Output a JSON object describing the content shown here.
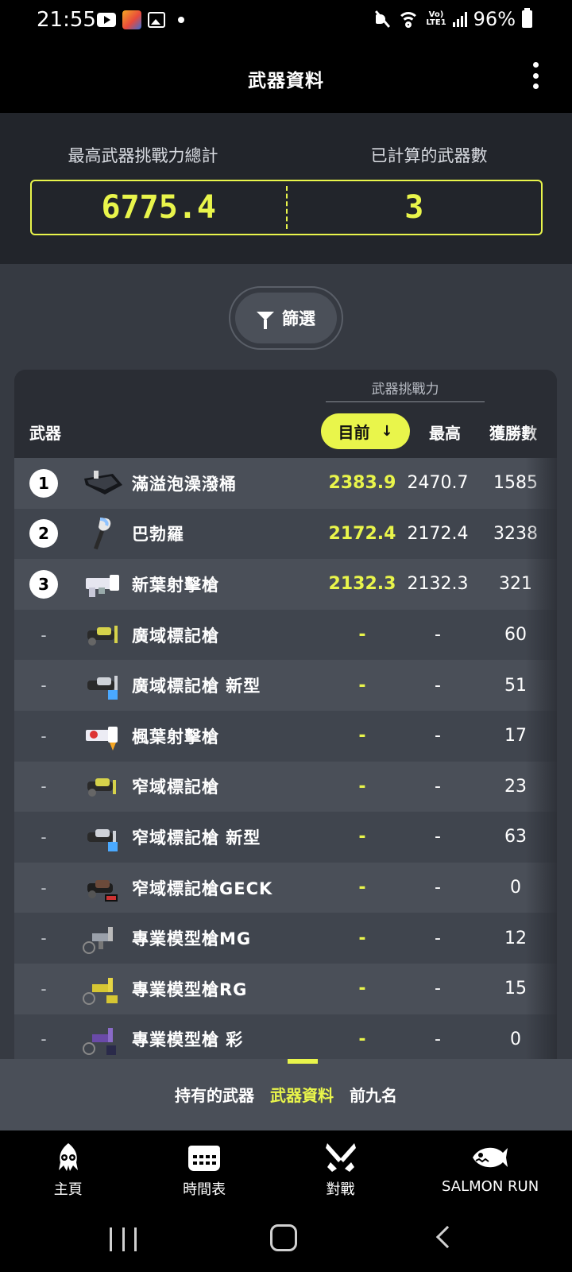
{
  "status_bar": {
    "time": "21:55",
    "battery": "96%",
    "network": "LTE1"
  },
  "header": {
    "title": "武器資料"
  },
  "summary": {
    "label_total": "最高武器挑戰力總計",
    "label_count": "已計算的武器數",
    "total_value": "6775.4",
    "count_value": "3"
  },
  "filter": {
    "label": "篩選"
  },
  "table": {
    "group_header": "武器挑戰力",
    "col_weapon": "武器",
    "col_current": "目前",
    "col_best": "最高",
    "col_wins": "獲勝數",
    "rows": [
      {
        "rank": "1",
        "name": "滿溢泡澡潑桶",
        "current": "2383.9",
        "best": "2470.7",
        "wins": "1585"
      },
      {
        "rank": "2",
        "name": "巴勃羅",
        "current": "2172.4",
        "best": "2172.4",
        "wins": "3238"
      },
      {
        "rank": "3",
        "name": "新葉射擊槍",
        "current": "2132.3",
        "best": "2132.3",
        "wins": "321"
      },
      {
        "rank": "-",
        "name": "廣域標記槍",
        "current": "-",
        "best": "-",
        "wins": "60"
      },
      {
        "rank": "-",
        "name": "廣域標記槍 新型",
        "current": "-",
        "best": "-",
        "wins": "51"
      },
      {
        "rank": "-",
        "name": "楓葉射擊槍",
        "current": "-",
        "best": "-",
        "wins": "17"
      },
      {
        "rank": "-",
        "name": "窄域標記槍",
        "current": "-",
        "best": "-",
        "wins": "23"
      },
      {
        "rank": "-",
        "name": "窄域標記槍 新型",
        "current": "-",
        "best": "-",
        "wins": "63"
      },
      {
        "rank": "-",
        "name": "窄域標記槍GECK",
        "current": "-",
        "best": "-",
        "wins": "0"
      },
      {
        "rank": "-",
        "name": "專業模型槍MG",
        "current": "-",
        "best": "-",
        "wins": "12"
      },
      {
        "rank": "-",
        "name": "專業模型槍RG",
        "current": "-",
        "best": "-",
        "wins": "15"
      },
      {
        "rank": "-",
        "name": "專業模型槍 彩",
        "current": "-",
        "best": "-",
        "wins": "0"
      }
    ]
  },
  "sub_tabs": [
    {
      "label": "持有的武器"
    },
    {
      "label": "武器資料"
    },
    {
      "label": "前九名"
    }
  ],
  "bottom_nav": [
    {
      "label": "主頁",
      "icon": "squid-icon"
    },
    {
      "label": "時間表",
      "icon": "calendar-icon"
    },
    {
      "label": "對戰",
      "icon": "battle-icon"
    },
    {
      "label": "SALMON RUN",
      "icon": "salmon-icon"
    }
  ],
  "colors": {
    "accent": "#e9f54b",
    "background": "#363a42",
    "row_odd": "#4a4f58",
    "row_even": "#40454e"
  }
}
